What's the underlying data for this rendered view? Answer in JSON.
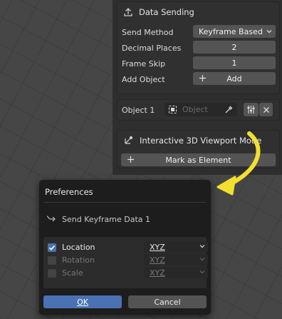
{
  "data_sending": {
    "title": "Data Sending",
    "send_method": {
      "label": "Send Method",
      "value": "Keyframe Based"
    },
    "decimal_places": {
      "label": "Decimal Places",
      "value": "2"
    },
    "frame_skip": {
      "label": "Frame Skip",
      "value": "1"
    },
    "add_object": {
      "label": "Add Object",
      "button": "Add"
    }
  },
  "object": {
    "label": "Object 1",
    "placeholder": "Object"
  },
  "interactive": {
    "title": "Interactive 3D Viewport Mode",
    "button": "Mark as Element"
  },
  "dialog": {
    "title": "Preferences",
    "subtitle": "Send Keyframe Data 1",
    "rows": [
      {
        "label": "Location",
        "axes": "XYZ",
        "checked": true
      },
      {
        "label": "Rotation",
        "axes": "XYZ",
        "checked": false
      },
      {
        "label": "Scale",
        "axes": "XYZ",
        "checked": false
      }
    ],
    "ok": "OK",
    "cancel": "Cancel"
  },
  "colors": {
    "accent": "#4a72b3",
    "arrow": "#f2e02e",
    "panel": "#303030",
    "field": "#545454"
  }
}
